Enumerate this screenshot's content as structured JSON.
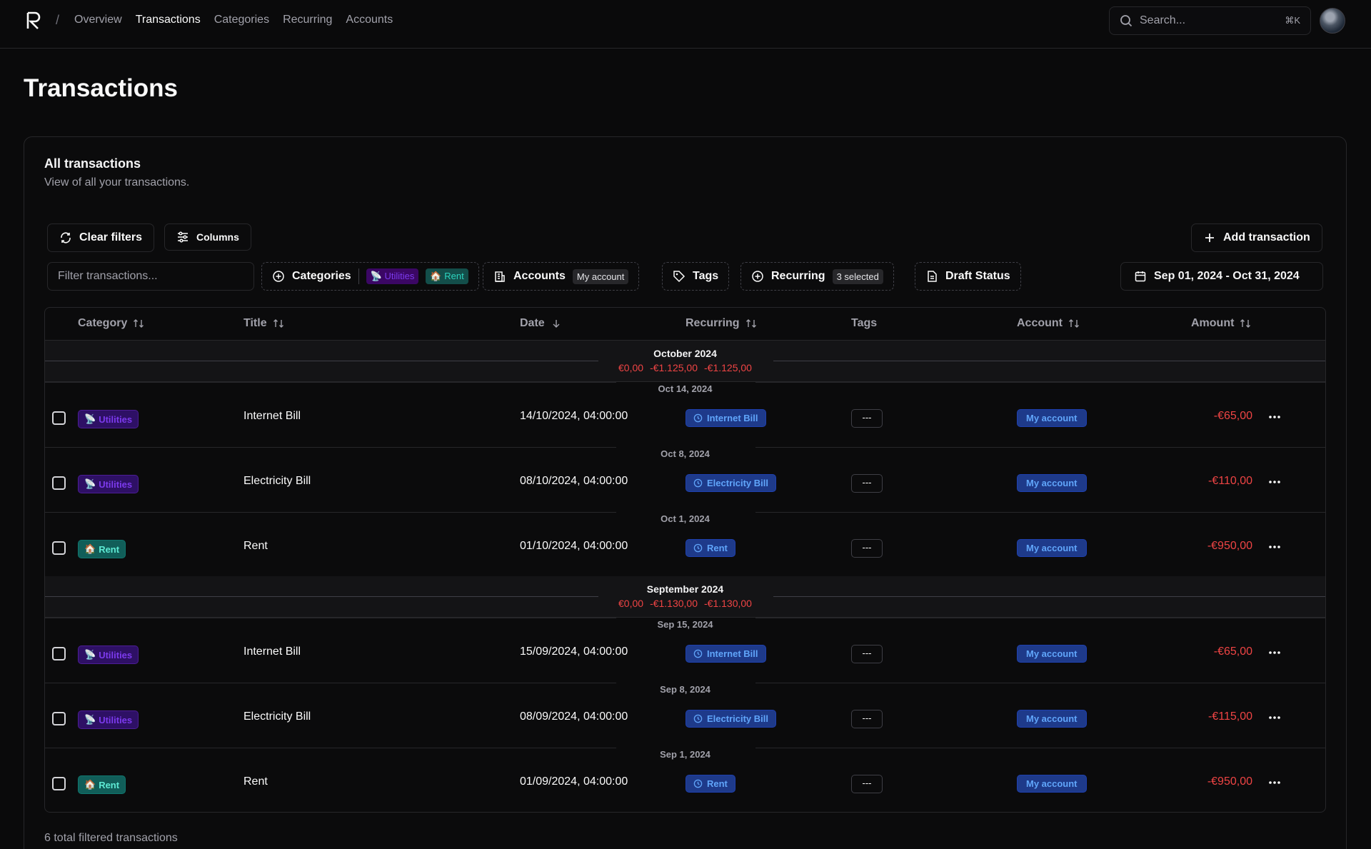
{
  "nav": {
    "separator": "/",
    "links": [
      "Overview",
      "Transactions",
      "Categories",
      "Recurring",
      "Accounts"
    ],
    "search_placeholder": "Search...",
    "shortcut": "⌘K"
  },
  "page_title": "Transactions",
  "card": {
    "title": "All transactions",
    "subtitle": "View of all your transactions."
  },
  "toolbar": {
    "clear_filters": "Clear filters",
    "columns": "Columns",
    "add_transaction": "Add transaction",
    "filter_placeholder": "Filter transactions...",
    "categories": "Categories",
    "categories_selected": [
      "Utilities",
      "Rent"
    ],
    "accounts": "Accounts",
    "accounts_selected": "My account",
    "tags": "Tags",
    "recurring": "Recurring",
    "recurring_selected": "3 selected",
    "draft_status": "Draft Status",
    "date_range": "Sep 01, 2024 - Oct 31, 2024"
  },
  "columns": {
    "category": "Category",
    "title": "Title",
    "date": "Date",
    "recurring": "Recurring",
    "tags": "Tags",
    "account": "Account",
    "amount": "Amount"
  },
  "months": [
    {
      "name": "October 2024",
      "sums": [
        "€0,00",
        "-€1.125,00",
        "-€1.125,00"
      ],
      "days": [
        {
          "label": "Oct 14, 2024",
          "row": {
            "category": "Utilities",
            "title": "Internet Bill",
            "date": "14/10/2024, 04:00:00",
            "recurring": "Internet Bill",
            "tags": "---",
            "account": "My account",
            "amount": "-€65,00"
          }
        },
        {
          "label": "Oct 8, 2024",
          "row": {
            "category": "Utilities",
            "title": "Electricity Bill",
            "date": "08/10/2024, 04:00:00",
            "recurring": "Electricity Bill",
            "tags": "---",
            "account": "My account",
            "amount": "-€110,00"
          }
        },
        {
          "label": "Oct 1, 2024",
          "row": {
            "category": "Rent",
            "title": "Rent",
            "date": "01/10/2024, 04:00:00",
            "recurring": "Rent",
            "tags": "---",
            "account": "My account",
            "amount": "-€950,00"
          }
        }
      ]
    },
    {
      "name": "September 2024",
      "sums": [
        "€0,00",
        "-€1.130,00",
        "-€1.130,00"
      ],
      "days": [
        {
          "label": "Sep 15, 2024",
          "row": {
            "category": "Utilities",
            "title": "Internet Bill",
            "date": "15/09/2024, 04:00:00",
            "recurring": "Internet Bill",
            "tags": "---",
            "account": "My account",
            "amount": "-€65,00"
          }
        },
        {
          "label": "Sep 8, 2024",
          "row": {
            "category": "Utilities",
            "title": "Electricity Bill",
            "date": "08/09/2024, 04:00:00",
            "recurring": "Electricity Bill",
            "tags": "---",
            "account": "My account",
            "amount": "-€115,00"
          }
        },
        {
          "label": "Sep 1, 2024",
          "row": {
            "category": "Rent",
            "title": "Rent",
            "date": "01/09/2024, 04:00:00",
            "recurring": "Rent",
            "tags": "---",
            "account": "My account",
            "amount": "-€950,00"
          }
        }
      ]
    }
  ],
  "footer": "6 total filtered transactions",
  "colors": {
    "accent_negative": "#ef4444",
    "utilities": "#7c3aed",
    "rent": "#2dd4bf",
    "link_badge": "#60a5fa"
  }
}
